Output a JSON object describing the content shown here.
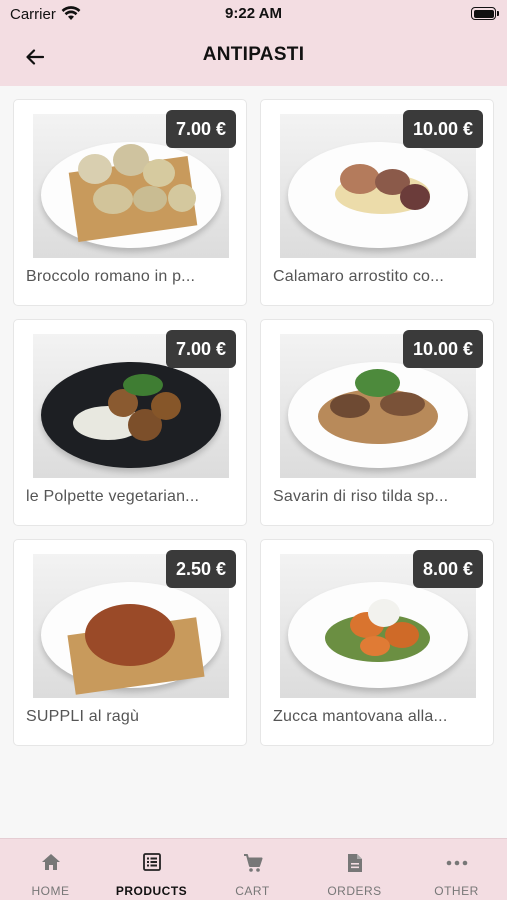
{
  "status_bar": {
    "carrier": "Carrier",
    "time": "9:22 AM"
  },
  "header": {
    "title": "ANTIPASTI",
    "back_icon": "arrow-left-icon"
  },
  "products": [
    {
      "name": "Broccolo romano in pastella",
      "display_name": "Broccolo romano in p...",
      "price": "7.00 €"
    },
    {
      "name": "Calamaro arrostito con crema",
      "display_name": "Calamaro arrostito co...",
      "price": "10.00 €"
    },
    {
      "name": "le Polpette vegetariane",
      "display_name": "le Polpette vegetarian...",
      "price": "7.00 €"
    },
    {
      "name": "Savarin di riso tilda speziato",
      "display_name": "Savarin di riso tilda sp...",
      "price": "10.00 €"
    },
    {
      "name": "SUPPLI al ragù",
      "display_name": "SUPPLI al ragù",
      "price": "2.50 €"
    },
    {
      "name": "Zucca mantovana alla brace",
      "display_name": "Zucca mantovana alla...",
      "price": "8.00 €"
    }
  ],
  "tabs": [
    {
      "label": "HOME",
      "icon": "home-icon",
      "active": false
    },
    {
      "label": "PRODUCTS",
      "icon": "list-icon",
      "active": true
    },
    {
      "label": "CART",
      "icon": "cart-icon",
      "active": false
    },
    {
      "label": "ORDERS",
      "icon": "document-icon",
      "active": false
    },
    {
      "label": "OTHER",
      "icon": "more-icon",
      "active": false
    }
  ],
  "colors": {
    "bar_background": "#f3dde2",
    "price_badge": "#3a3a3a",
    "page_background": "#f7f7f7"
  }
}
